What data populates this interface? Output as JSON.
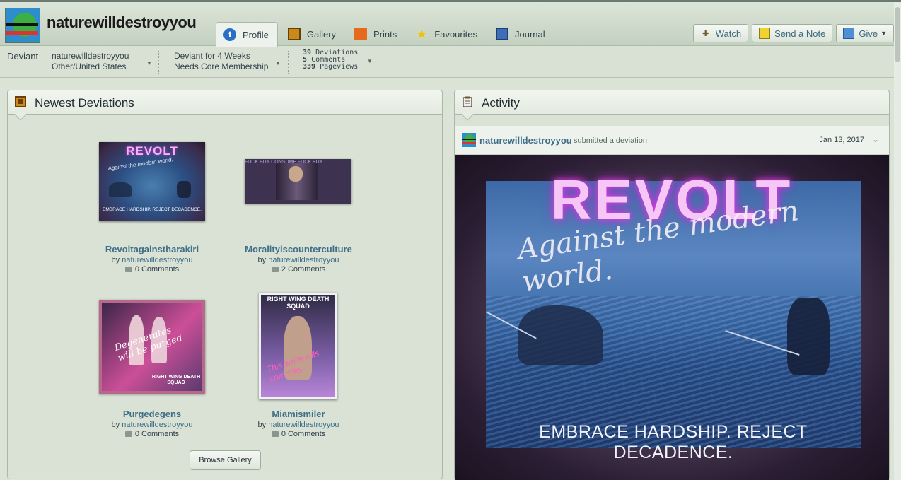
{
  "header": {
    "username": "naturewilldestroyyou",
    "tabs": [
      {
        "label": "Profile",
        "icon": "info-icon",
        "active": true
      },
      {
        "label": "Gallery",
        "icon": "gallery-icon"
      },
      {
        "label": "Prints",
        "icon": "prints-icon"
      },
      {
        "label": "Favourites",
        "icon": "star-icon"
      },
      {
        "label": "Journal",
        "icon": "journal-icon"
      }
    ],
    "actions": {
      "watch": "Watch",
      "note": "Send a Note",
      "give": "Give"
    }
  },
  "info": {
    "deviant_label": "Deviant",
    "name": "naturewilldestroyyou",
    "location": "Other/United States",
    "tenure": "Deviant for 4 Weeks",
    "membership": "Needs Core Membership",
    "stats": {
      "deviations": "39",
      "deviations_label": "Deviations",
      "comments": "5",
      "comments_label": "Comments",
      "pageviews": "339",
      "pageviews_label": "Pageviews"
    }
  },
  "newest": {
    "title": "Newest Deviations",
    "browse": "Browse Gallery",
    "items": [
      {
        "title": "Revoltagainstharakiri",
        "by": "by",
        "author": "naturewilldestroyyou",
        "comments": "0 Comments",
        "art_text_1": "REVOLT",
        "art_text_2": "Against the modern world.",
        "art_text_3": "EMBRACE HARDSHIP. REJECT DECADENCE."
      },
      {
        "title": "Moralityiscounterculture",
        "by": "by",
        "author": "naturewilldestroyyou",
        "comments": "2 Comments",
        "art_text_1": "FUCK BUY CONSUME FUCK BUY"
      },
      {
        "title": "Purgedegens",
        "by": "by",
        "author": "naturewilldestroyyou",
        "comments": "0 Comments",
        "art_text_1": "Degenerates will be purged",
        "art_text_2": "RIGHT WING DEATH SQUAD"
      },
      {
        "title": "Miamismiler",
        "by": "by",
        "author": "naturewilldestroyyou",
        "comments": "0 Comments",
        "art_text_1": "RIGHT WING DEATH SQUAD",
        "art_text_2": "This smile kills commies"
      }
    ]
  },
  "activity": {
    "title": "Activity",
    "user": "naturewilldestroyyou",
    "action": "submitted a deviation",
    "date": "Jan 13, 2017",
    "art": {
      "headline": "REVOLT",
      "script": "Against the modern world.",
      "footer": "EMBRACE HARDSHIP. REJECT DECADENCE."
    }
  }
}
